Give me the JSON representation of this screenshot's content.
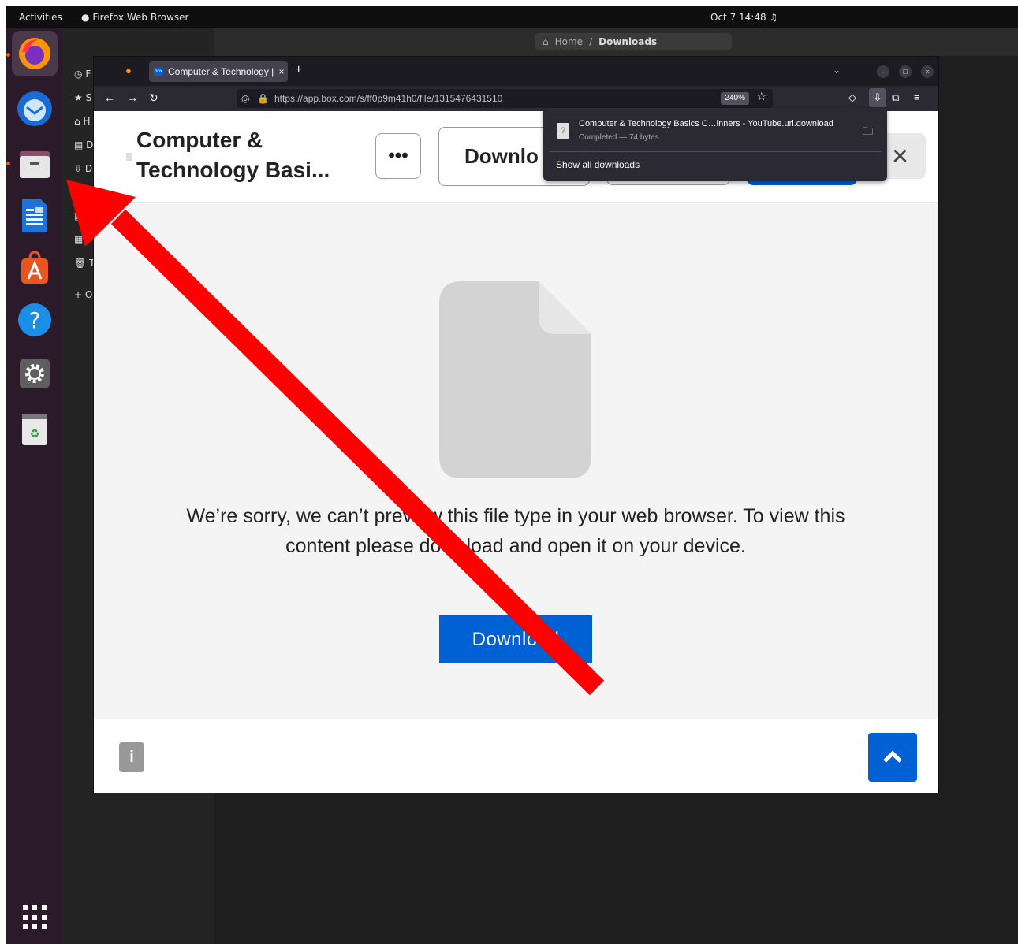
{
  "topbar": {
    "activities": "Activities",
    "app_name": "Firefox Web Browser",
    "clock": "Oct 7  14:48"
  },
  "files_window": {
    "path_home": "Home",
    "path_sep": "/",
    "path_current": "Downloads",
    "sidebar_initials": [
      "F",
      "S",
      "H",
      "D",
      "D",
      "",
      "",
      "T",
      "O"
    ]
  },
  "browser": {
    "tab_label": "Computer & Technology |",
    "url": "https://app.box.com/s/ff0p9m41h0/file/1315476431510",
    "url_domain": "box.com",
    "zoom": "240%"
  },
  "box_page": {
    "title": "Computer & Technology Basi...",
    "more_label": "•••",
    "header_download": "Downlo",
    "message": "We’re sorry, we can’t preview this file type in your web browser. To view this content please download and open it on your device.",
    "download_label": "Download"
  },
  "downloads_panel": {
    "file_name": "Computer & Technology Basics C…inners - YouTube.url.download",
    "status": "Completed — 74 bytes",
    "show_all": "Show all downloads"
  },
  "colors": {
    "box_blue": "#0061d5",
    "annotation_arrow": "#ff0000",
    "dock_bg": "#2b1b2a"
  }
}
